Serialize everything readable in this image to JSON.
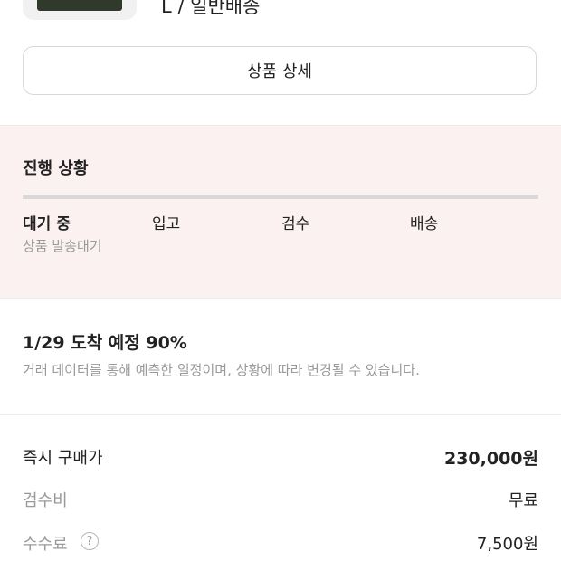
{
  "product": {
    "option_text": "L / 일반배송",
    "image_icon": "product-image"
  },
  "detail_button_label": "상품 상세",
  "progress": {
    "title": "진행 상황",
    "steps": [
      "대기 중",
      "입고",
      "검수",
      "배송"
    ],
    "active_step_index": 0,
    "active_sub_label": "상품 발송대기"
  },
  "arrival": {
    "title": "1/29 도착 예정 90%",
    "note": "거래 데이터를 통해 예측한 일정이며, 상황에 따라 변경될 수 있습니다."
  },
  "pricing": {
    "rows": [
      {
        "label": "즉시 구매가",
        "value": "230,000원"
      },
      {
        "label": "검수비",
        "value": "무료"
      },
      {
        "label": "수수료",
        "value": "7,500원"
      }
    ],
    "help_icon": "question-circle-icon",
    "help_glyph": "?"
  },
  "colors": {
    "progress_background": "#fbf1f1",
    "muted_text": "#9a9a9a"
  }
}
